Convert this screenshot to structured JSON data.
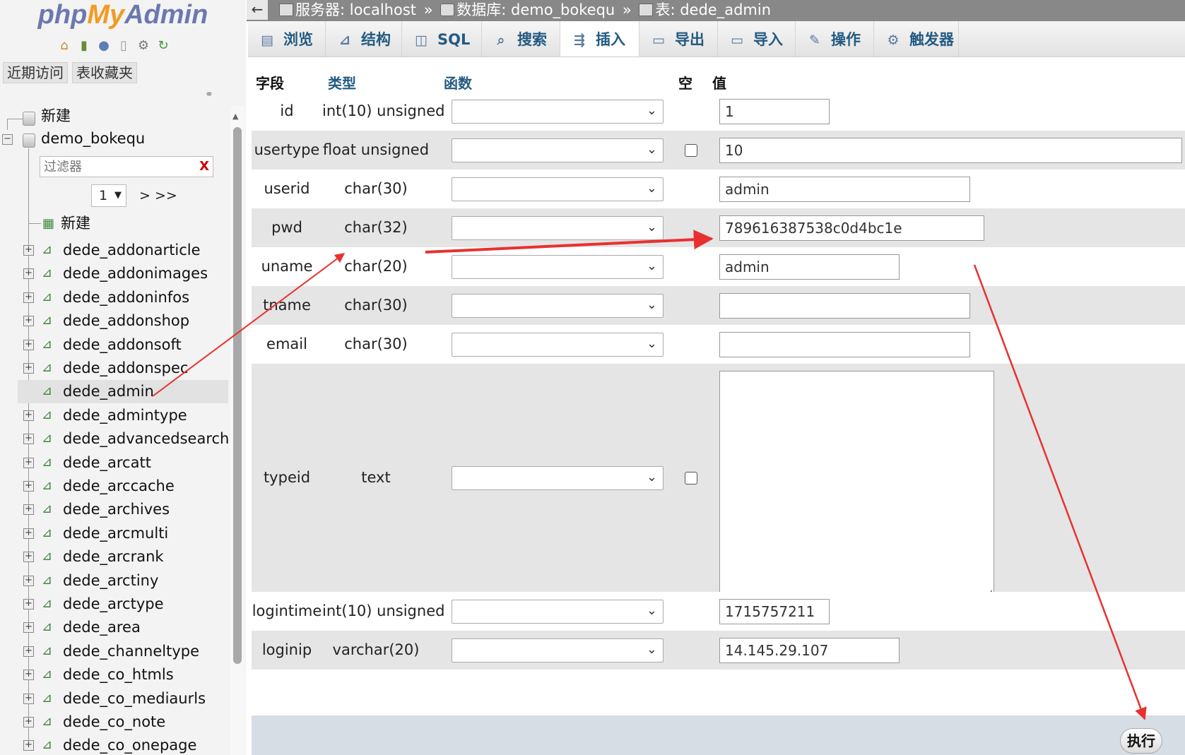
{
  "sidebar": {
    "logo": {
      "php": "php",
      "my": "My",
      "admin": "Admin"
    },
    "nav_icons": [
      "home-icon",
      "exit-icon",
      "help-icon",
      "docs-icon",
      "settings-icon",
      "reload-icon"
    ],
    "quick_tabs": [
      "近期访问",
      "表收藏夹"
    ],
    "new_label": "新建",
    "database": "demo_bokequ",
    "filter_placeholder": "过滤器",
    "filter_clear": "X",
    "page_select": "1",
    "page_next": "> >>",
    "db_new_label": "新建",
    "selected_table": "dede_admin",
    "tables": [
      "dede_addonarticle",
      "dede_addonimages",
      "dede_addoninfos",
      "dede_addonshop",
      "dede_addonsoft",
      "dede_addonspec",
      "dede_admin",
      "dede_admintype",
      "dede_advancedsearch",
      "dede_arcatt",
      "dede_arccache",
      "dede_archives",
      "dede_arcmulti",
      "dede_arcrank",
      "dede_arctiny",
      "dede_arctype",
      "dede_area",
      "dede_channeltype",
      "dede_co_htmls",
      "dede_co_mediaurls",
      "dede_co_note",
      "dede_co_onepage"
    ]
  },
  "breadcrumb": {
    "back": "←",
    "server_label": "服务器: localhost",
    "db_label": "数据库: demo_bokequ",
    "table_label": "表: dede_admin",
    "separator": "»"
  },
  "tabs": [
    {
      "label": "浏览",
      "icon": "browse-icon"
    },
    {
      "label": "结构",
      "icon": "structure-icon"
    },
    {
      "label": "SQL",
      "icon": "sql-icon"
    },
    {
      "label": "搜索",
      "icon": "search-icon"
    },
    {
      "label": "插入",
      "icon": "insert-icon",
      "active": true
    },
    {
      "label": "导出",
      "icon": "export-icon"
    },
    {
      "label": "导入",
      "icon": "import-icon"
    },
    {
      "label": "操作",
      "icon": "operations-icon"
    },
    {
      "label": "触发器",
      "icon": "triggers-icon"
    }
  ],
  "form": {
    "headers": {
      "field": "字段",
      "type": "类型",
      "function": "函数",
      "null": "空",
      "value": "值"
    },
    "rows": [
      {
        "field": "id",
        "type": "int(10) unsigned",
        "value": "1",
        "nullable": false
      },
      {
        "field": "usertype",
        "type": "float unsigned",
        "value": "10",
        "nullable": true
      },
      {
        "field": "userid",
        "type": "char(30)",
        "value": "admin",
        "nullable": false
      },
      {
        "field": "pwd",
        "type": "char(32)",
        "value": "789616387538c0d4bc1e",
        "nullable": false
      },
      {
        "field": "uname",
        "type": "char(20)",
        "value": "admin",
        "nullable": false
      },
      {
        "field": "tname",
        "type": "char(30)",
        "value": "",
        "nullable": false
      },
      {
        "field": "email",
        "type": "char(30)",
        "value": "",
        "nullable": false
      },
      {
        "field": "typeid",
        "type": "text",
        "value": "",
        "nullable": true
      },
      {
        "field": "logintime",
        "type": "int(10) unsigned",
        "value": "1715757211",
        "nullable": false
      },
      {
        "field": "loginip",
        "type": "varchar(20)",
        "value": "14.145.29.107",
        "nullable": false
      }
    ],
    "go_button": "执行"
  },
  "colors": {
    "topbar": "#888888",
    "tab_text": "#235a81",
    "row_alt": "#e5e5e5",
    "annotation": "#e8312f"
  }
}
